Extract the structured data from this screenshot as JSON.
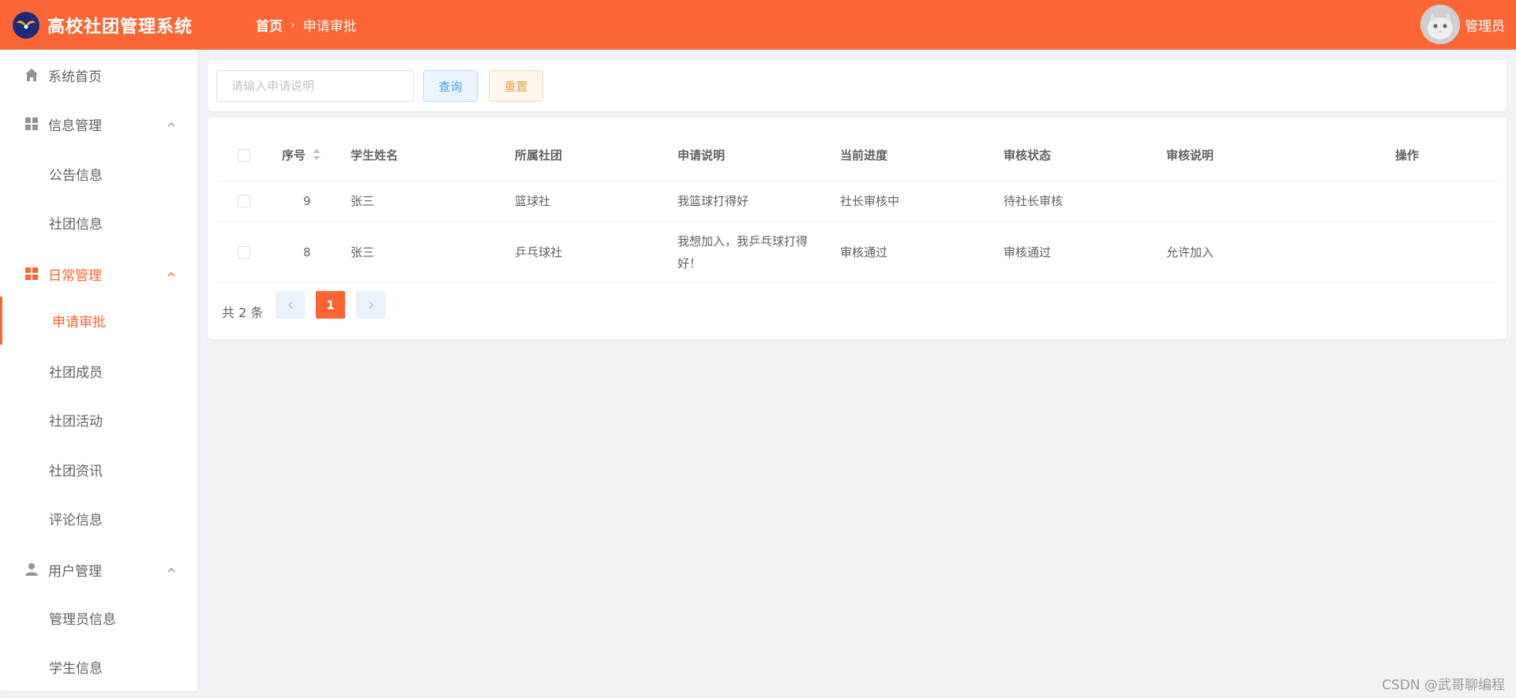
{
  "app": {
    "title": "高校社团管理系统"
  },
  "breadcrumb": {
    "home": "首页",
    "separator": "›",
    "current": "申请审批"
  },
  "user": {
    "name": "管理员"
  },
  "sidebar": {
    "home": "系统首页",
    "info_group": "信息管理",
    "notice": "公告信息",
    "club_info": "社团信息",
    "daily_group": "日常管理",
    "apply_review": "申请审批",
    "club_members": "社团成员",
    "club_activity": "社团活动",
    "club_news": "社团资讯",
    "comments": "评论信息",
    "user_group": "用户管理",
    "admin_info": "管理员信息",
    "student_info": "学生信息"
  },
  "search": {
    "placeholder": "请输入申请说明",
    "value": "",
    "query_label": "查询",
    "reset_label": "重置"
  },
  "table": {
    "headers": {
      "index": "序号",
      "student": "学生姓名",
      "club": "所属社团",
      "desc": "申请说明",
      "progress": "当前进度",
      "status": "审核状态",
      "note": "审核说明",
      "action": "操作"
    },
    "rows": [
      {
        "index": "9",
        "student": "张三",
        "club": "篮球社",
        "desc": "我篮球打得好",
        "progress": "社长审核中",
        "status": "待社长审核",
        "note": ""
      },
      {
        "index": "8",
        "student": "张三",
        "club": "乒乓球社",
        "desc": "我想加入，我乒乓球打得好！",
        "progress": "审核通过",
        "status": "审核通过",
        "note": "允许加入"
      }
    ]
  },
  "pager": {
    "total": "共 2 条",
    "current": "1"
  },
  "watermark": "CSDN @武哥聊编程",
  "colors": {
    "primary": "#fc6634",
    "background": "#f0f2f5"
  }
}
